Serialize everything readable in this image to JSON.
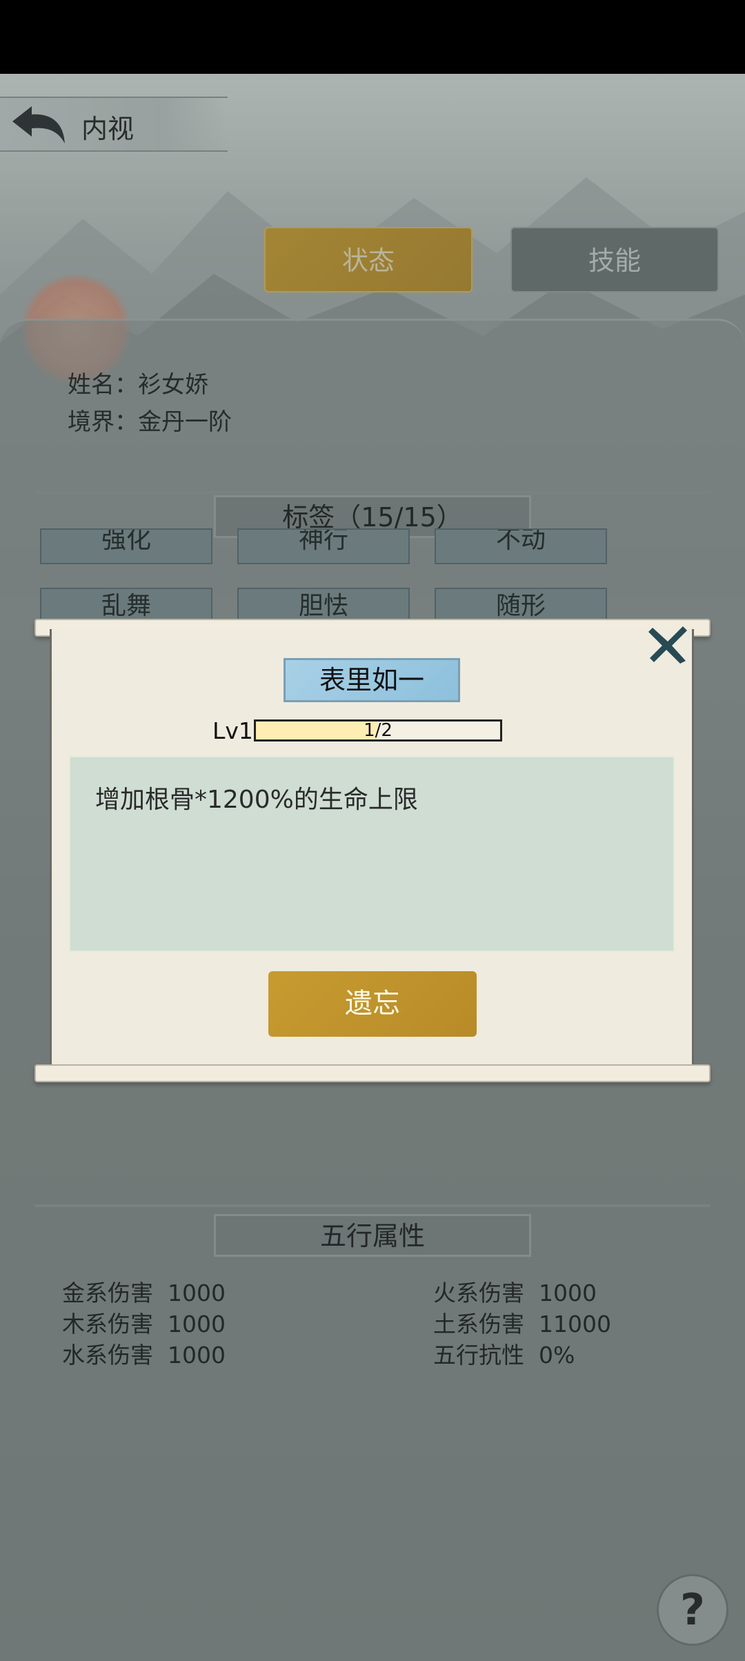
{
  "header": {
    "title": "内视"
  },
  "tabs": [
    {
      "label": "状态"
    },
    {
      "label": "技能"
    }
  ],
  "profile": {
    "name": "姓名：衫女娇",
    "realm": "境界：金丹一阶"
  },
  "tags_section": {
    "title": "标签（15/15）",
    "visible_tags": [
      "强化",
      "神行",
      "不动",
      "乱舞",
      "胆怯",
      "随形"
    ]
  },
  "tag_dialog": {
    "tag_name": "表里如一",
    "level": "Lv1",
    "progress_text": "1/2",
    "progress": 0.5,
    "description": "增加根骨*1200%的生命上限",
    "forget_label": "遗忘"
  },
  "elements_section": {
    "title": "五行属性",
    "left": [
      {
        "label": "金系伤害",
        "value": "1000"
      },
      {
        "label": "木系伤害",
        "value": "1000"
      },
      {
        "label": "水系伤害",
        "value": "1000"
      }
    ],
    "right": [
      {
        "label": "火系伤害",
        "value": "1000"
      },
      {
        "label": "土系伤害",
        "value": "11000"
      },
      {
        "label": "五行抗性",
        "value": "0%"
      }
    ]
  },
  "help": {
    "label": "?"
  },
  "colors": {
    "gold": "#c69a2f",
    "tag_blue": "#a8d0e6",
    "desc_bg": "#cfddd2",
    "scroll_paper": "#efebdf"
  }
}
